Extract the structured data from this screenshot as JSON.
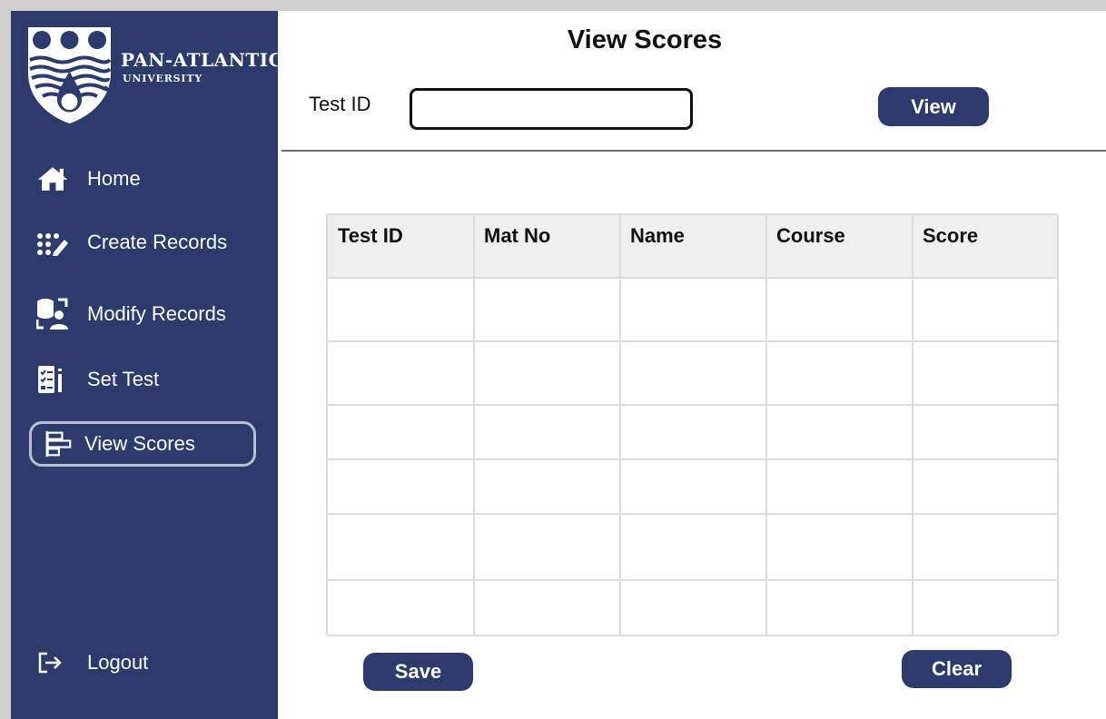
{
  "brand": {
    "name": "PAN-ATLANTIC",
    "subtitle": "UNIVERSITY"
  },
  "sidebar": {
    "items": [
      {
        "label": "Home",
        "icon": "home-icon"
      },
      {
        "label": "Create Records",
        "icon": "create-records-icon"
      },
      {
        "label": "Modify Records",
        "icon": "modify-records-icon"
      },
      {
        "label": "Set Test",
        "icon": "set-test-icon"
      },
      {
        "label": "View Scores",
        "icon": "view-scores-icon",
        "active": true
      }
    ],
    "logout": {
      "label": "Logout",
      "icon": "logout-icon"
    }
  },
  "main": {
    "title": "View Scores",
    "test_id_label": "Test ID",
    "test_id_value": "",
    "view_button": "View",
    "table": {
      "columns": [
        "Test ID",
        "Mat No",
        "Name",
        "Course",
        "Score"
      ],
      "rows": [
        [
          "",
          "",
          "",
          "",
          ""
        ],
        [
          "",
          "",
          "",
          "",
          ""
        ],
        [
          "",
          "",
          "",
          "",
          ""
        ],
        [
          "",
          "",
          "",
          "",
          ""
        ],
        [
          "",
          "",
          "",
          "",
          ""
        ],
        [
          "",
          "",
          "",
          "",
          ""
        ]
      ]
    },
    "save_button": "Save",
    "clear_button": "Clear"
  },
  "colors": {
    "sidebar_bg": "#2c3b6b",
    "button_bg": "#2c3b6b",
    "table_header_bg": "#efefef",
    "table_border": "#dcdcdc"
  }
}
